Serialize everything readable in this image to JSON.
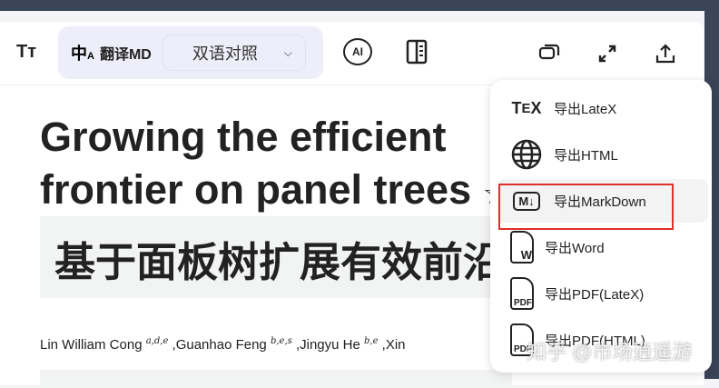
{
  "toolbar": {
    "font_icon": "Tт",
    "translate_label": "翻译MD",
    "mode_select": "双语对照",
    "ai_icon": "AI"
  },
  "paper": {
    "title": "Growing the efficient frontier on panel trees",
    "star": "☆",
    "title_zh": "基于面板树扩展有效前沿",
    "authors": [
      {
        "name": "Lin William Cong",
        "sup": "a,d,e"
      },
      {
        "name": ",Guanhao Feng",
        "sup": "b,e,s"
      },
      {
        "name": ",Jingyu He",
        "sup": "b,e"
      },
      {
        "name": ",Xin",
        "sup": ""
      }
    ]
  },
  "export_menu": {
    "items": [
      {
        "label": "导出LateX",
        "icon": "tex-icon"
      },
      {
        "label": "导出HTML",
        "icon": "globe-icon"
      },
      {
        "label": "导出MarkDown",
        "icon": "markdown-icon"
      },
      {
        "label": "导出Word",
        "icon": "word-file-icon"
      },
      {
        "label": "导出PDF(LateX)",
        "icon": "pdf-file-icon"
      },
      {
        "label": "导出PDF(HTML)",
        "icon": "pdf-file-icon"
      }
    ]
  },
  "watermark": "知乎 @市场逍遥游"
}
